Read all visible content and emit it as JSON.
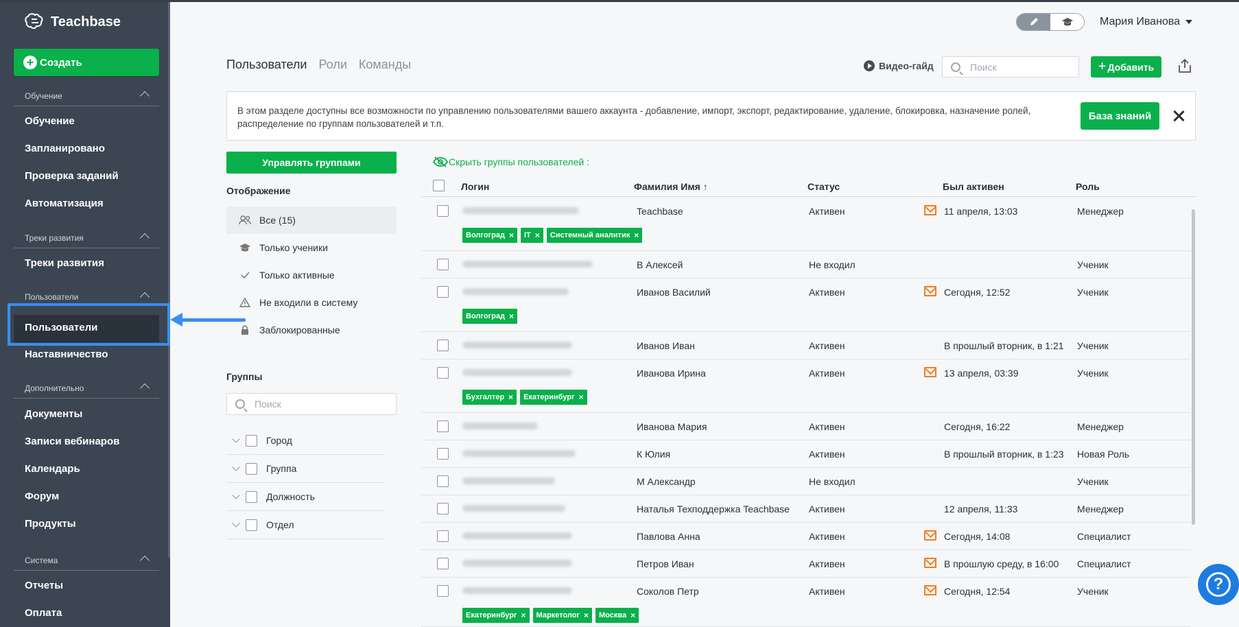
{
  "app": {
    "logo_text": "Teachbase"
  },
  "sidebar": {
    "create_label": "Создать",
    "sections": [
      {
        "title": "Обучение",
        "items": [
          "Обучение",
          "Запланировано",
          "Проверка заданий",
          "Автоматизация"
        ]
      },
      {
        "title": "Треки развития",
        "items": [
          "Треки развития"
        ]
      },
      {
        "title": "Пользователи",
        "items": [
          "Пользователи",
          "Наставничество"
        ]
      },
      {
        "title": "Дополнительно",
        "items": [
          "Документы",
          "Записи вебинаров",
          "Календарь",
          "Форум",
          "Продукты"
        ]
      },
      {
        "title": "Система",
        "items": [
          "Отчеты",
          "Оплата"
        ]
      }
    ],
    "active_item": "Пользователи"
  },
  "header": {
    "user_name": "Мария Иванова",
    "tabs": [
      {
        "label": "Пользователи",
        "active": true
      },
      {
        "label": "Роли",
        "active": false
      },
      {
        "label": "Команды",
        "active": false
      }
    ],
    "video_guide": "Видео-гайд",
    "search_placeholder": "Поиск",
    "add_label": "Добавить"
  },
  "banner": {
    "text": "В этом разделе доступны все возможности по управлению пользователями вашего аккаунта - добавление, импорт, экспорт, редактирование, удаление, блокировка, назначение ролей, распределение по группам пользователей и т.п.",
    "kb_label": "База знаний"
  },
  "filters": {
    "manage_groups": "Управлять группами",
    "display_title": "Отображение",
    "items": [
      {
        "label": "Все (15)",
        "icon": "users-icon",
        "selected": true
      },
      {
        "label": "Только ученики",
        "icon": "graduation-cap-icon",
        "selected": false
      },
      {
        "label": "Только активные",
        "icon": "check-icon",
        "selected": false
      },
      {
        "label": "Не входили в систему",
        "icon": "warning-icon",
        "selected": false
      },
      {
        "label": "Заблокированные",
        "icon": "lock-icon",
        "selected": false
      }
    ],
    "groups_title": "Группы",
    "groups_search_placeholder": "Поиск",
    "groups": [
      "Город",
      "Группа",
      "Должность",
      "Отдел"
    ]
  },
  "table": {
    "hide_groups_label": "Скрыть группы пользователей :",
    "columns": [
      "Логин",
      "Фамилия Имя",
      "Статус",
      "Был активен",
      "Роль"
    ],
    "rows": [
      {
        "name": "Teachbase",
        "status": "Активен",
        "mail": true,
        "active": "11 апреля, 13:03",
        "role": "Менеджер",
        "tags": [
          "Волгоград",
          "IT",
          "Системный аналитик"
        ]
      },
      {
        "name": "В Алексей",
        "status": "Не входил",
        "mail": false,
        "active": "",
        "role": "Ученик",
        "tags": []
      },
      {
        "name": "Иванов Василий",
        "status": "Активен",
        "mail": true,
        "active": "Сегодня, 12:52",
        "role": "Ученик",
        "tags": [
          "Волгоград"
        ]
      },
      {
        "name": "Иванов Иван",
        "status": "Активен",
        "mail": false,
        "active": "В прошлый вторник, в 1:21",
        "role": "Ученик",
        "tags": []
      },
      {
        "name": "Иванова Ирина",
        "status": "Активен",
        "mail": true,
        "active": "13 апреля, 03:39",
        "role": "Ученик",
        "tags": [
          "Бухгалтер",
          "Екатеринбург"
        ]
      },
      {
        "name": "Иванова Мария",
        "status": "Активен",
        "mail": false,
        "active": "Сегодня, 16:22",
        "role": "Менеджер",
        "tags": []
      },
      {
        "name": "К Юлия",
        "status": "Активен",
        "mail": false,
        "active": "В прошлый вторник, в 1:23",
        "role": "Новая Роль",
        "tags": []
      },
      {
        "name": "М Александр",
        "status": "Не входил",
        "mail": false,
        "active": "",
        "role": "Ученик",
        "tags": []
      },
      {
        "name": "Наталья Техподдержка Teachbase",
        "status": "Активен",
        "mail": false,
        "active": "12 апреля, 11:33",
        "role": "Менеджер",
        "tags": []
      },
      {
        "name": "Павлова Анна",
        "status": "Активен",
        "mail": true,
        "active": "Сегодня, 14:08",
        "role": "Специалист",
        "tags": []
      },
      {
        "name": "Петров Иван",
        "status": "Активен",
        "mail": true,
        "active": "В прошлую среду, в 16:00",
        "role": "Специалист",
        "tags": []
      },
      {
        "name": "Соколов Петр",
        "status": "Активен",
        "mail": true,
        "active": "Сегодня, 12:54",
        "role": "Ученик",
        "tags": [
          "Екатеринбург",
          "Маркетолог",
          "Москва"
        ]
      }
    ]
  },
  "colors": {
    "accent": "#0ab04b",
    "sidebar_bg": "#3c4652",
    "highlight": "#3a8ef0",
    "mail": "#f07e22"
  }
}
